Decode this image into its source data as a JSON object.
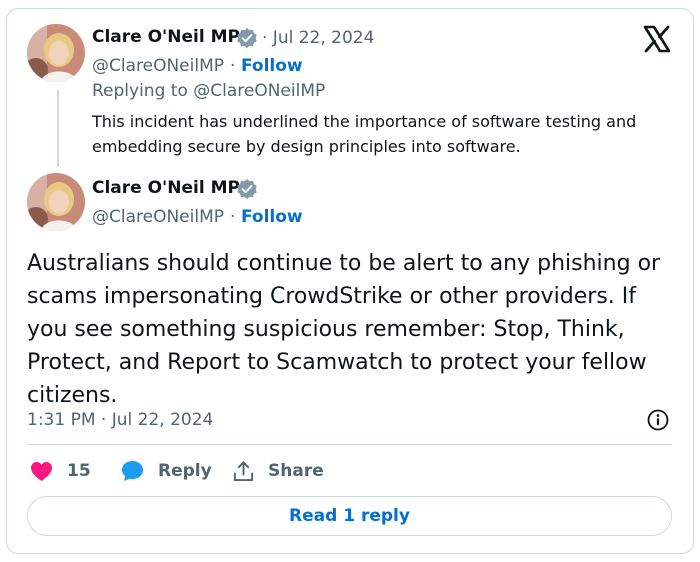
{
  "quoted_tweet": {
    "author_name": "Clare O'Neil MP",
    "verified_icon": "verified-badge-icon",
    "separator_date": "· Jul 22, 2024",
    "handle": "@ClareONeilMP",
    "handle_sep": "·",
    "follow_label": "Follow",
    "replying_to": "Replying to @ClareONeilMP",
    "text": "This incident has underlined the importance of software testing and embedding secure by design principles into software."
  },
  "main_tweet": {
    "author_name": "Clare O'Neil MP",
    "handle": "@ClareONeilMP",
    "handle_sep": "·",
    "follow_label": "Follow",
    "text": "Australians should continue to be alert to any phishing or scams impersonating CrowdStrike or other providers. If you see something suspicious remember: Stop, Think, Protect, and Report to Scamwatch to protect your fellow citizens.",
    "timestamp": "1:31 PM · Jul 22, 2024"
  },
  "actions": {
    "like_count": "15",
    "reply_label": "Reply",
    "share_label": "Share"
  },
  "footer": {
    "read_replies_label": "Read 1 reply"
  },
  "icons": {
    "platform": "x-logo-icon",
    "info": "info-icon",
    "like": "heart-icon",
    "reply": "speech-bubble-icon",
    "share": "share-icon"
  },
  "colors": {
    "accent_link": "#006fd6",
    "like_pink": "#f91880",
    "reply_blue": "#1d9bf0",
    "verified_gray": "#829aab",
    "muted_text": "#536471",
    "border": "#cfd9de"
  }
}
